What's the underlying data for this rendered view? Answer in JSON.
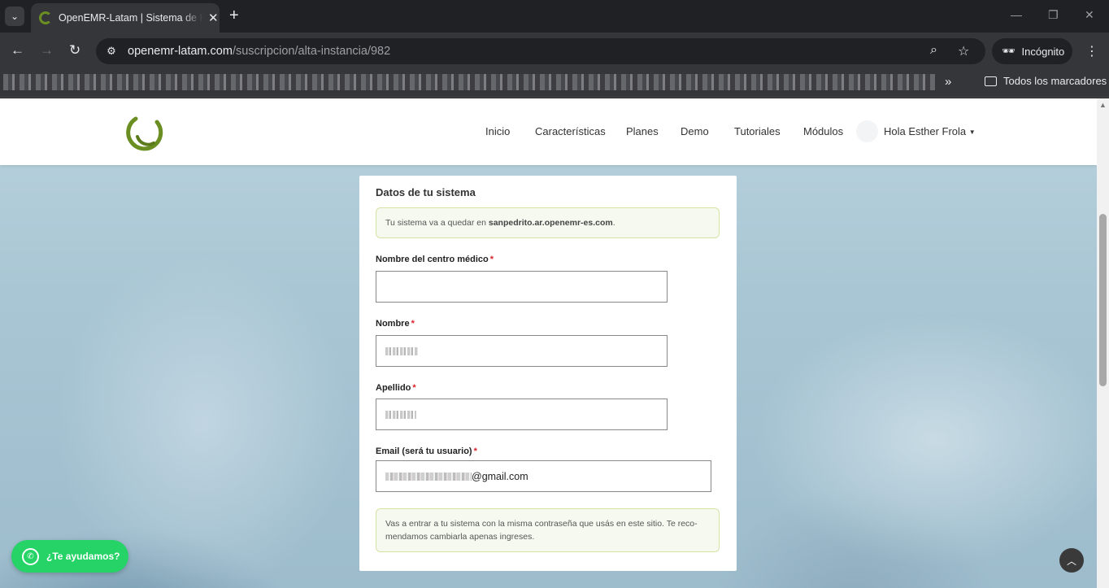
{
  "browser": {
    "tab_title": "OpenEMR-Latam | Sistema de Historias Clínicas",
    "url_host": "openemr-latam.com",
    "url_path": "/suscripcion/alta-instancia/982",
    "incognito_label": "Incógnito",
    "bookmarks_all_label": "Todos los marcadores"
  },
  "site": {
    "brand_color": "#6b8e23",
    "nav": [
      "Inicio",
      "Características",
      "Planes",
      "Demo",
      "Tutoriales",
      "Módulos"
    ],
    "user_greeting": "Hola Esther Frola"
  },
  "form": {
    "title": "Datos de tu sistema",
    "domain_notice_prefix": "Tu sistema va a quedar en ",
    "domain": "sanpedrito.ar.openemr-es.com",
    "domain_notice_suffix": ".",
    "fields": {
      "center_label": "Nombre del centro médico",
      "name_label": "Nombre",
      "surname_label": "Apellido",
      "email_label": "Email (será tu usuario)",
      "email_suffix": "@gmail.com"
    },
    "required_mark": "*",
    "password_notice": "Vas a entrar a tu sistema con la misma contraseña que usás en este sitio. Te reco-mendamos cambiarla apenas ingreses."
  },
  "widgets": {
    "whatsapp_label": "¿Te ayudamos?",
    "whatsapp_color": "#25d366"
  }
}
